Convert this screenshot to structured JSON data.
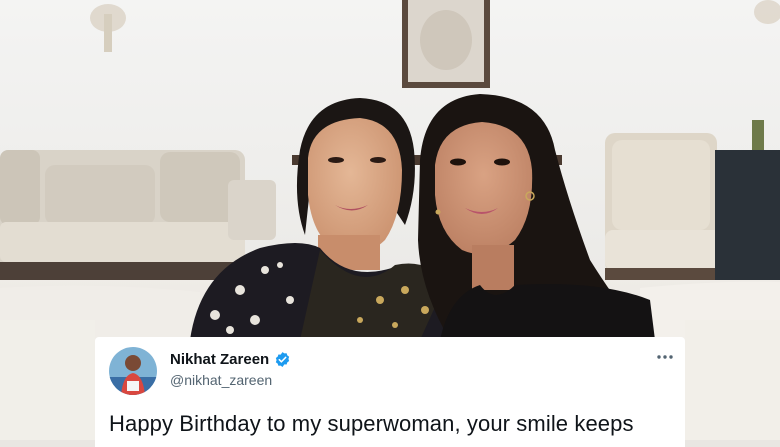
{
  "tweet": {
    "display_name": "Nikhat Zareen",
    "handle": "@nikhat_zareen",
    "verified_icon": "verified-badge-icon",
    "more_icon": "more-options-icon",
    "text": "Happy Birthday to my superwoman, your smile keeps"
  },
  "colors": {
    "verified_blue": "#1d9bf0",
    "name_text": "#0f1419",
    "handle_text": "#536471"
  }
}
